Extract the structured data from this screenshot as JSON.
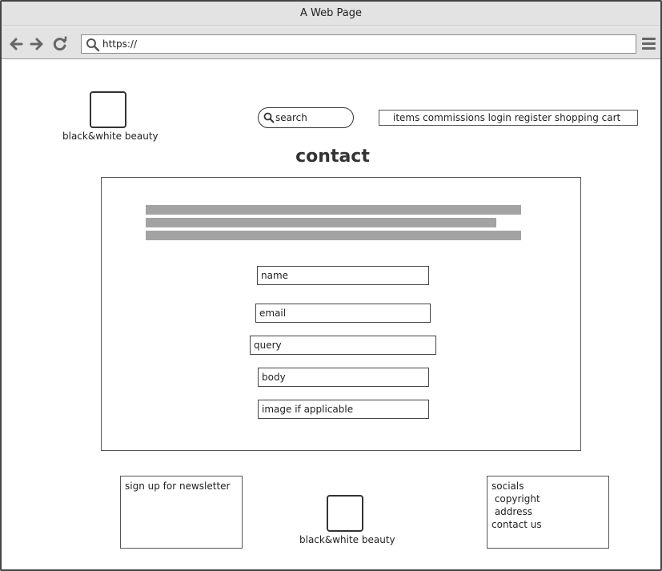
{
  "window": {
    "title": "A Web Page"
  },
  "browser": {
    "url": "https://",
    "icons": {
      "back": "arrow-left-icon",
      "forward": "arrow-right-icon",
      "reload": "reload-icon",
      "url": "search-icon",
      "menu": "hamburger-menu-icon"
    }
  },
  "header": {
    "brand": "black&white beauty",
    "search_label": "search",
    "nav_links": "items commissions login register shopping cart"
  },
  "main": {
    "title": "contact",
    "form": {
      "fields": [
        {
          "label": "name"
        },
        {
          "label": "email"
        },
        {
          "label": "query"
        },
        {
          "label": "body"
        },
        {
          "label": "image if applicable"
        }
      ]
    }
  },
  "footer": {
    "newsletter": "sign up for newsletter",
    "brand": "black&white beauty",
    "links": [
      "socials",
      " copyright",
      " address",
      "contact us"
    ]
  },
  "colors": {
    "chrome": "#e3e3e3",
    "placeholder_text": "#a3a3a3",
    "border": "#444444"
  }
}
